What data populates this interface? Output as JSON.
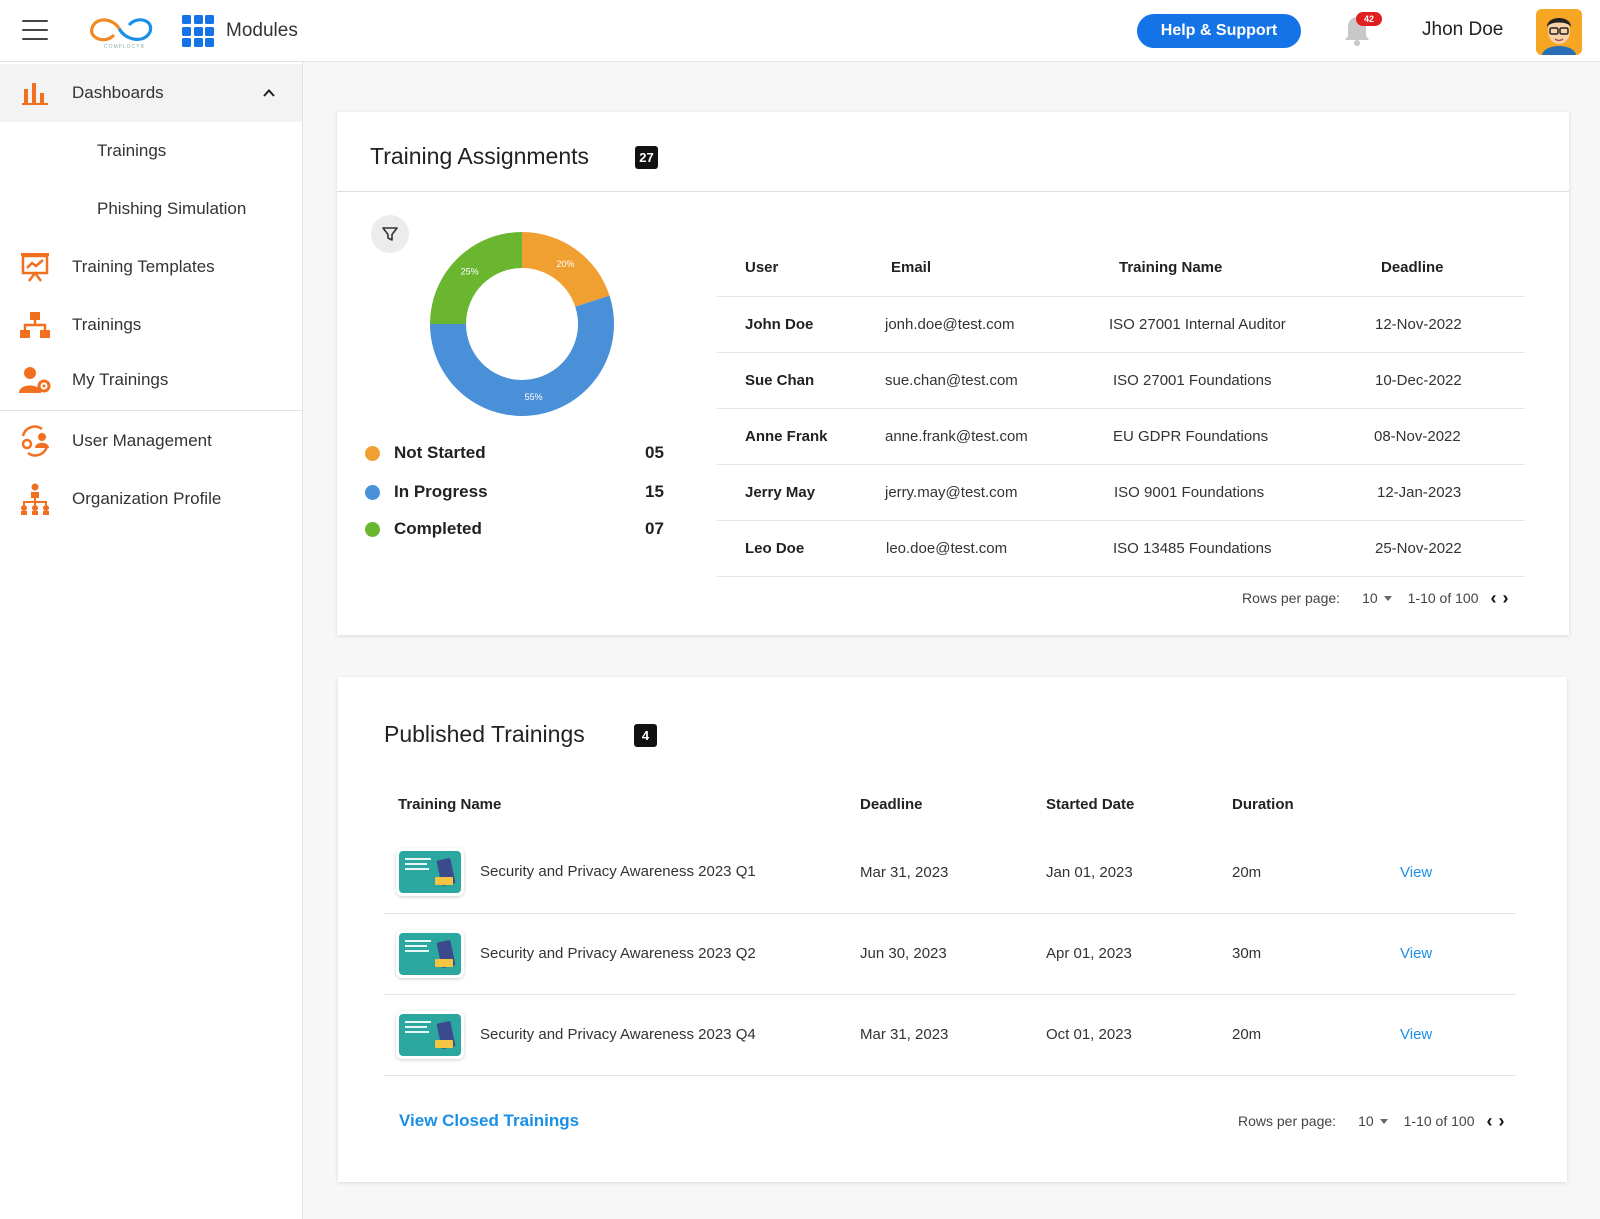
{
  "header": {
    "logo_text": "COMPLOCYB",
    "modules_label": "Modules",
    "help_label": "Help & Support",
    "notification_count": "42",
    "username": "Jhon Doe"
  },
  "sidebar": {
    "items": [
      {
        "label": "Dashboards",
        "icon": "bar-chart-icon"
      },
      {
        "label": "Trainings"
      },
      {
        "label": "Phishing Simulation"
      },
      {
        "label": "Training Templates",
        "icon": "presentation-chart-icon"
      },
      {
        "label": "Trainings",
        "icon": "hierarchy-icon"
      },
      {
        "label": "My Trainings",
        "icon": "user-gear-icon"
      },
      {
        "label": "User Management",
        "icon": "user-cycle-icon"
      },
      {
        "label": "Organization Profile",
        "icon": "org-chart-icon"
      }
    ]
  },
  "assignments": {
    "title": "Training Assignments",
    "count": "27",
    "chart_data": {
      "type": "pie",
      "categories": [
        "Not Started",
        "In Progress",
        "Completed"
      ],
      "values": [
        20,
        55,
        25
      ],
      "value_labels": [
        "20%",
        "55%",
        "25%"
      ],
      "colors": [
        "#f0a030",
        "#4a90d9",
        "#6ab62f"
      ]
    },
    "legend": [
      {
        "label": "Not Started",
        "value": "05",
        "color": "#f0a030"
      },
      {
        "label": "In Progress",
        "value": "15",
        "color": "#4a90d9"
      },
      {
        "label": "Completed",
        "value": "07",
        "color": "#6ab62f"
      }
    ],
    "columns": [
      "User",
      "Email",
      "Training Name",
      "Deadline"
    ],
    "rows": [
      {
        "user": "John Doe",
        "email": "jonh.doe@test.com",
        "training": "ISO 27001 Internal Auditor",
        "deadline": "12-Nov-2022"
      },
      {
        "user": "Sue Chan",
        "email": "sue.chan@test.com",
        "training": "ISO 27001 Foundations",
        "deadline": "10-Dec-2022"
      },
      {
        "user": "Anne Frank",
        "email": "anne.frank@test.com",
        "training": "EU GDPR Foundations",
        "deadline": "08-Nov-2022"
      },
      {
        "user": "Jerry May",
        "email": "jerry.may@test.com",
        "training": "ISO 9001 Foundations",
        "deadline": "12-Jan-2023"
      },
      {
        "user": "Leo Doe",
        "email": "leo.doe@test.com",
        "training": "ISO 13485 Foundations",
        "deadline": "25-Nov-2022"
      }
    ],
    "pager": {
      "rows_label": "Rows per page:",
      "rows_value": "10",
      "range": "1-10 of 100"
    }
  },
  "published": {
    "title": "Published Trainings",
    "count": "4",
    "columns": [
      "Training Name",
      "Deadline",
      "Started Date",
      "Duration"
    ],
    "rows": [
      {
        "name": "Security and Privacy Awareness 2023 Q1",
        "deadline": "Mar 31, 2023",
        "started": "Jan 01, 2023",
        "duration": "20m",
        "action": "View"
      },
      {
        "name": "Security and Privacy Awareness 2023 Q2",
        "deadline": "Jun 30, 2023",
        "started": "Apr 01, 2023",
        "duration": "30m",
        "action": "View"
      },
      {
        "name": "Security and Privacy Awareness 2023 Q4",
        "deadline": "Mar 31, 2023",
        "started": "Oct 01, 2023",
        "duration": "20m",
        "action": "View"
      }
    ],
    "closed_link": "View Closed Trainings",
    "pager": {
      "rows_label": "Rows per page:",
      "rows_value": "10",
      "range": "1-10 of 100"
    }
  }
}
